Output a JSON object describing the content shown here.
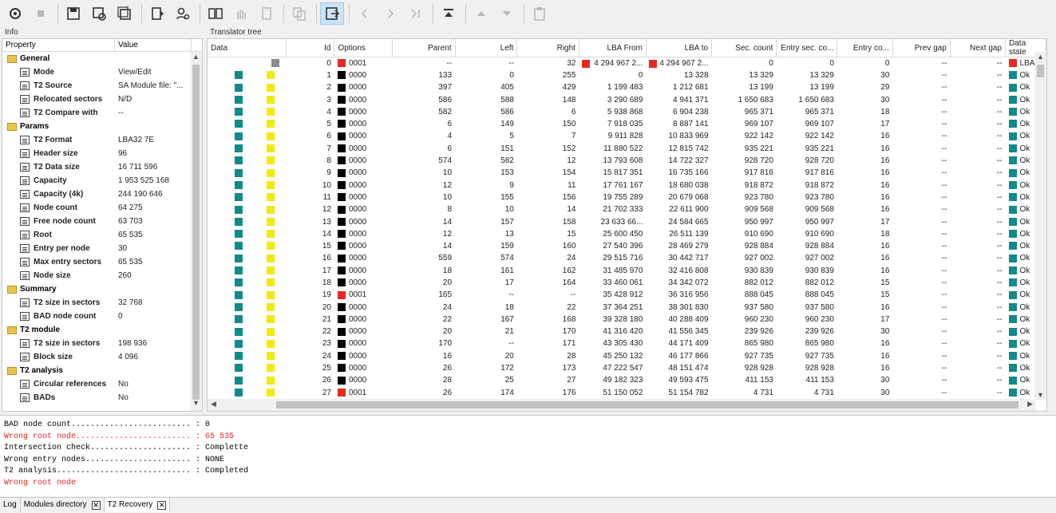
{
  "toolbar": {
    "buttons": [
      {
        "icon": "disk-settings-icon",
        "state": "normal"
      },
      {
        "icon": "stop-icon",
        "state": "disabled"
      },
      {
        "icon": "save-icon",
        "state": "normal"
      },
      {
        "icon": "save-settings-icon",
        "state": "normal"
      },
      {
        "icon": "save-all-icon",
        "state": "normal"
      },
      {
        "icon": "add-page-icon",
        "state": "normal"
      },
      {
        "icon": "user-search-icon",
        "state": "normal"
      },
      {
        "icon": "binary-view-icon",
        "state": "normal"
      },
      {
        "icon": "hand-icon",
        "state": "disabled"
      },
      {
        "icon": "page-icon",
        "state": "disabled"
      },
      {
        "icon": "copy-icon",
        "state": "disabled"
      },
      {
        "icon": "export-icon",
        "state": "active"
      },
      {
        "icon": "prev-icon",
        "state": "disabled"
      },
      {
        "icon": "next-icon",
        "state": "disabled"
      },
      {
        "icon": "skip-end-icon",
        "state": "disabled"
      },
      {
        "icon": "to-top-icon",
        "state": "normal"
      },
      {
        "icon": "up-icon",
        "state": "disabled"
      },
      {
        "icon": "down-icon",
        "state": "disabled"
      },
      {
        "icon": "clipboard-icon",
        "state": "disabled"
      }
    ]
  },
  "info": {
    "title": "Info",
    "col_property": "Property",
    "col_value": "Value",
    "rows": [
      {
        "t": "g",
        "k": "General",
        "v": ""
      },
      {
        "t": "i",
        "k": "Mode",
        "v": "View/Edit"
      },
      {
        "t": "i",
        "k": "T2 Source",
        "v": "SA Module file: \"..."
      },
      {
        "t": "i",
        "k": "Relocated sectors",
        "v": "N/D"
      },
      {
        "t": "i",
        "k": "T2 Compare with",
        "v": "--"
      },
      {
        "t": "g",
        "k": "Params",
        "v": ""
      },
      {
        "t": "i",
        "k": "T2 Format",
        "v": "LBA32 7E"
      },
      {
        "t": "i",
        "k": "Header size",
        "v": "96"
      },
      {
        "t": "i",
        "k": "T2 Data size",
        "v": "16 711 596"
      },
      {
        "t": "i",
        "k": "Capacity",
        "v": "1 953 525 168"
      },
      {
        "t": "i",
        "k": "Capacity (4k)",
        "v": "244 190 646"
      },
      {
        "t": "i",
        "k": "Node count",
        "v": "64 275"
      },
      {
        "t": "i",
        "k": "Free node count",
        "v": "63 703"
      },
      {
        "t": "i",
        "k": "Root",
        "v": "65 535"
      },
      {
        "t": "i",
        "k": "Entry per node",
        "v": "30"
      },
      {
        "t": "i",
        "k": "Max entry sectors",
        "v": "65 535"
      },
      {
        "t": "i",
        "k": "Node size",
        "v": "260"
      },
      {
        "t": "g",
        "k": "Summary",
        "v": ""
      },
      {
        "t": "i",
        "k": "T2 size in sectors",
        "v": "32 768"
      },
      {
        "t": "i",
        "k": "BAD node count",
        "v": "0"
      },
      {
        "t": "g",
        "k": "T2 module",
        "v": ""
      },
      {
        "t": "i",
        "k": "T2 size in sectors",
        "v": "198 936"
      },
      {
        "t": "i",
        "k": "Block size",
        "v": "4 096"
      },
      {
        "t": "g",
        "k": "T2 analysis",
        "v": ""
      },
      {
        "t": "i",
        "k": "Circular references",
        "v": "No"
      },
      {
        "t": "i",
        "k": "BADs",
        "v": "No"
      }
    ]
  },
  "tree": {
    "title": "Translator tree",
    "columns": [
      "Data",
      "Id",
      "Options",
      "Parent",
      "Left",
      "Right",
      "LBA From",
      "LBA to",
      "Sec. count",
      "Entry sec. co...",
      "Entry co...",
      "Prev gap",
      "Next gap",
      "Data state"
    ],
    "rows": [
      [
        "gray",
        "0",
        "red",
        "0001",
        "--",
        "--",
        "32",
        "red",
        "4 294 967 2...",
        "red",
        "4 294 967 2...",
        "0",
        "0",
        "0",
        "--",
        "--",
        "red",
        "LBA"
      ],
      [
        "teal",
        "1",
        "black",
        "0000",
        "133",
        "0",
        "255",
        "",
        "0",
        "",
        "13 328",
        "13 329",
        "13 329",
        "30",
        "--",
        "--",
        "teal",
        "Ok"
      ],
      [
        "teal",
        "2",
        "black",
        "0000",
        "397",
        "405",
        "429",
        "",
        "1 199 483",
        "",
        "1 212 681",
        "13 199",
        "13 199",
        "29",
        "--",
        "--",
        "teal",
        "Ok"
      ],
      [
        "teal",
        "3",
        "black",
        "0000",
        "586",
        "588",
        "148",
        "",
        "3 290 689",
        "",
        "4 941 371",
        "1 650 683",
        "1 650 683",
        "30",
        "--",
        "--",
        "teal",
        "Ok"
      ],
      [
        "teal",
        "4",
        "black",
        "0000",
        "582",
        "586",
        "6",
        "",
        "5 938 868",
        "",
        "6 904 238",
        "965 371",
        "965 371",
        "18",
        "--",
        "--",
        "teal",
        "Ok"
      ],
      [
        "teal",
        "5",
        "black",
        "0000",
        "6",
        "149",
        "150",
        "",
        "7 918 035",
        "",
        "8 887 141",
        "969 107",
        "969 107",
        "17",
        "--",
        "--",
        "teal",
        "Ok"
      ],
      [
        "teal",
        "6",
        "black",
        "0000",
        "4",
        "5",
        "7",
        "",
        "9 911 828",
        "",
        "10 833 969",
        "922 142",
        "922 142",
        "16",
        "--",
        "--",
        "teal",
        "Ok"
      ],
      [
        "teal",
        "7",
        "black",
        "0000",
        "6",
        "151",
        "152",
        "",
        "11 880 522",
        "",
        "12 815 742",
        "935 221",
        "935 221",
        "16",
        "--",
        "--",
        "teal",
        "Ok"
      ],
      [
        "teal",
        "8",
        "black",
        "0000",
        "574",
        "582",
        "12",
        "",
        "13 793 608",
        "",
        "14 722 327",
        "928 720",
        "928 720",
        "16",
        "--",
        "--",
        "teal",
        "Ok"
      ],
      [
        "teal",
        "9",
        "black",
        "0000",
        "10",
        "153",
        "154",
        "",
        "15 817 351",
        "",
        "16 735 166",
        "917 816",
        "917 816",
        "16",
        "--",
        "--",
        "teal",
        "Ok"
      ],
      [
        "teal",
        "10",
        "black",
        "0000",
        "12",
        "9",
        "11",
        "",
        "17 761 167",
        "",
        "18 680 038",
        "918 872",
        "918 872",
        "16",
        "--",
        "--",
        "teal",
        "Ok"
      ],
      [
        "teal",
        "11",
        "black",
        "0000",
        "10",
        "155",
        "156",
        "",
        "19 755 289",
        "",
        "20 679 068",
        "923 780",
        "923 780",
        "16",
        "--",
        "--",
        "teal",
        "Ok"
      ],
      [
        "teal",
        "12",
        "black",
        "0000",
        "8",
        "10",
        "14",
        "",
        "21 702 333",
        "",
        "22 611 900",
        "909 568",
        "909 568",
        "16",
        "--",
        "--",
        "teal",
        "Ok"
      ],
      [
        "teal",
        "13",
        "black",
        "0000",
        "14",
        "157",
        "158",
        "",
        "23 633 66...",
        "",
        "24 584 665",
        "950 997",
        "950 997",
        "17",
        "--",
        "--",
        "teal",
        "Ok"
      ],
      [
        "teal",
        "14",
        "black",
        "0000",
        "12",
        "13",
        "15",
        "",
        "25 600 450",
        "",
        "26 511 139",
        "910 690",
        "910 690",
        "18",
        "--",
        "--",
        "teal",
        "Ok"
      ],
      [
        "teal",
        "15",
        "black",
        "0000",
        "14",
        "159",
        "160",
        "",
        "27 540 396",
        "",
        "28 469 279",
        "928 884",
        "928 884",
        "16",
        "--",
        "--",
        "teal",
        "Ok"
      ],
      [
        "teal",
        "16",
        "black",
        "0000",
        "559",
        "574",
        "24",
        "",
        "29 515 716",
        "",
        "30 442 717",
        "927 002",
        "927 002",
        "16",
        "--",
        "--",
        "teal",
        "Ok"
      ],
      [
        "teal",
        "17",
        "black",
        "0000",
        "18",
        "161",
        "162",
        "",
        "31 485 970",
        "",
        "32 416 808",
        "930 839",
        "930 839",
        "16",
        "--",
        "--",
        "teal",
        "Ok"
      ],
      [
        "teal",
        "18",
        "black",
        "0000",
        "20",
        "17",
        "164",
        "",
        "33 460 061",
        "",
        "34 342 072",
        "882 012",
        "882 012",
        "15",
        "--",
        "--",
        "teal",
        "Ok"
      ],
      [
        "teal",
        "19",
        "red",
        "0001",
        "165",
        "--",
        "--",
        "",
        "35 428 912",
        "",
        "36 316 956",
        "888 045",
        "888 045",
        "15",
        "--",
        "--",
        "teal",
        "Ok"
      ],
      [
        "teal",
        "20",
        "black",
        "0000",
        "24",
        "18",
        "22",
        "",
        "37 364 251",
        "",
        "38 301 830",
        "937 580",
        "937 580",
        "16",
        "--",
        "--",
        "teal",
        "Ok"
      ],
      [
        "teal",
        "21",
        "black",
        "0000",
        "22",
        "167",
        "168",
        "",
        "39 328 180",
        "",
        "40 288 409",
        "960 230",
        "960 230",
        "17",
        "--",
        "--",
        "teal",
        "Ok"
      ],
      [
        "teal",
        "22",
        "black",
        "0000",
        "20",
        "21",
        "170",
        "",
        "41 316 420",
        "",
        "41 556 345",
        "239 926",
        "239 926",
        "30",
        "--",
        "--",
        "teal",
        "Ok"
      ],
      [
        "teal",
        "23",
        "black",
        "0000",
        "170",
        "--",
        "171",
        "",
        "43 305 430",
        "",
        "44 171 409",
        "865 980",
        "865 980",
        "16",
        "--",
        "--",
        "teal",
        "Ok"
      ],
      [
        "teal",
        "24",
        "black",
        "0000",
        "16",
        "20",
        "28",
        "",
        "45 250 132",
        "",
        "46 177 866",
        "927 735",
        "927 735",
        "16",
        "--",
        "--",
        "teal",
        "Ok"
      ],
      [
        "teal",
        "25",
        "black",
        "0000",
        "26",
        "172",
        "173",
        "",
        "47 222 547",
        "",
        "48 151 474",
        "928 928",
        "928 928",
        "16",
        "--",
        "--",
        "teal",
        "Ok"
      ],
      [
        "teal",
        "26",
        "black",
        "0000",
        "28",
        "25",
        "27",
        "",
        "49 182 323",
        "",
        "49 593 475",
        "411 153",
        "411 153",
        "30",
        "--",
        "--",
        "teal",
        "Ok"
      ],
      [
        "teal",
        "27",
        "red",
        "0001",
        "26",
        "174",
        "176",
        "",
        "51 150 052",
        "",
        "51 154 782",
        "4 731",
        "4 731",
        "30",
        "--",
        "--",
        "teal",
        "Ok"
      ]
    ]
  },
  "log": {
    "lines": [
      {
        "text": "BAD node count......................... : 0",
        "red": false
      },
      {
        "text": "Wrong root node........................ : 65 535",
        "red": true
      },
      {
        "text": "Intersection check..................... : Complette",
        "red": false
      },
      {
        "text": "Wrong entry nodes...................... : NONE",
        "red": false
      },
      {
        "text": "T2 analysis............................ : Completed",
        "red": false
      },
      {
        "text": "Wrong root node",
        "red": true
      }
    ]
  },
  "tabs": [
    {
      "label": "Log",
      "closable": false,
      "selected": false
    },
    {
      "label": "Modules directory",
      "closable": true,
      "selected": false
    },
    {
      "label": "T2 Recovery",
      "closable": true,
      "selected": true
    }
  ]
}
